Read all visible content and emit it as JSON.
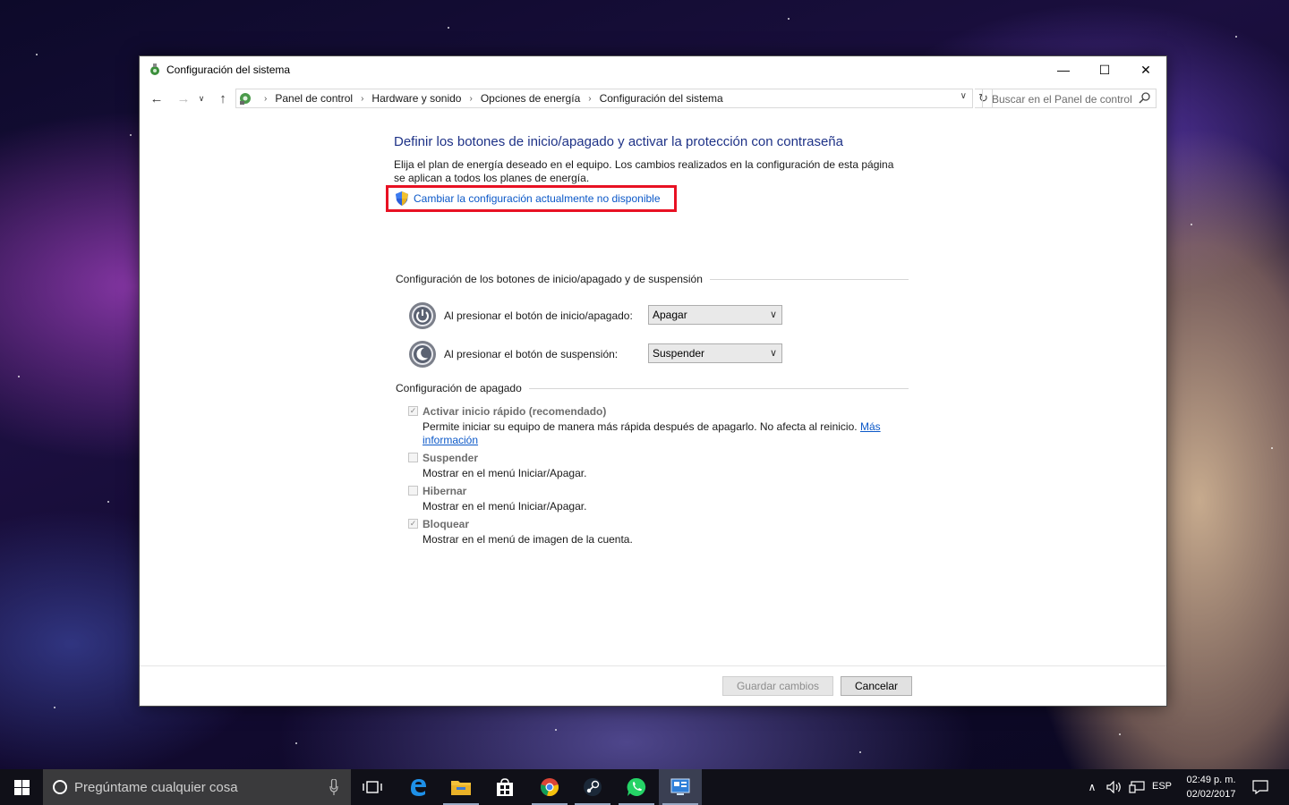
{
  "window": {
    "title": "Configuración del sistema",
    "controls": {
      "minimize": "—",
      "maximize": "☐",
      "close": "✕"
    }
  },
  "address": {
    "breadcrumb": [
      "Panel de control",
      "Hardware y sonido",
      "Opciones de energía",
      "Configuración del sistema"
    ],
    "search_placeholder": "Buscar en el Panel de control"
  },
  "page": {
    "heading": "Definir los botones de inicio/apagado y activar la protección con contraseña",
    "description": "Elija el plan de energía deseado en el equipo. Los cambios realizados en la configuración de esta página se aplican a todos los planes de energía.",
    "change_link": "Cambiar la configuración actualmente no disponible",
    "highlight_color": "#e81123",
    "buttons_section": "Configuración de los botones de inicio/apagado y de suspensión",
    "power_button_label": "Al presionar el botón de inicio/apagado:",
    "power_button_value": "Apagar",
    "sleep_button_label": "Al presionar el botón de suspensión:",
    "sleep_button_value": "Suspender",
    "shutdown_section": "Configuración de apagado",
    "options": [
      {
        "name": "Activar inicio rápido (recomendado)",
        "checked": true,
        "desc": "Permite iniciar su equipo de manera más rápida después de apagarlo. No afecta al reinicio.",
        "link": "Más información"
      },
      {
        "name": "Suspender",
        "checked": false,
        "desc": "Mostrar en el menú Iniciar/Apagar."
      },
      {
        "name": "Hibernar",
        "checked": false,
        "desc": "Mostrar en el menú Iniciar/Apagar."
      },
      {
        "name": "Bloquear",
        "checked": true,
        "desc": "Mostrar en el menú de imagen de la cuenta."
      }
    ],
    "save_label": "Guardar cambios",
    "cancel_label": "Cancelar"
  },
  "taskbar": {
    "search_placeholder": "Pregúntame cualquier cosa",
    "apps": [
      "task-view-icon",
      "edge-icon",
      "file-explorer-icon",
      "store-icon",
      "chrome-icon",
      "steam-icon",
      "whatsapp-icon",
      "control-panel-icon"
    ],
    "language": "ESP",
    "time": "02:49 p. m.",
    "date": "02/02/2017"
  }
}
